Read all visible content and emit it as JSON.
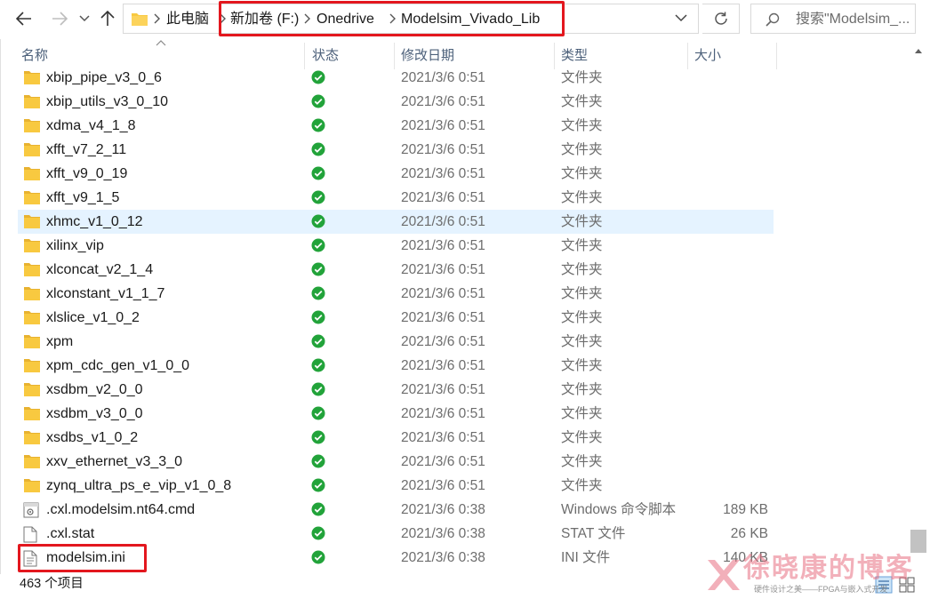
{
  "breadcrumbs": [
    "此电脑",
    "新加卷 (F:)",
    "Onedrive",
    "Modelsim_Vivado_Lib"
  ],
  "search": {
    "placeholder": "搜索\"Modelsim_..."
  },
  "columns": {
    "name": "名称",
    "status": "状态",
    "date": "修改日期",
    "type": "类型",
    "size": "大小"
  },
  "files": [
    {
      "name": "xbip_pipe_v3_0_6",
      "date": "2021/3/6 0:51",
      "type": "文件夹",
      "size": "",
      "icon": "folder-icon"
    },
    {
      "name": "xbip_utils_v3_0_10",
      "date": "2021/3/6 0:51",
      "type": "文件夹",
      "size": "",
      "icon": "folder-icon"
    },
    {
      "name": "xdma_v4_1_8",
      "date": "2021/3/6 0:51",
      "type": "文件夹",
      "size": "",
      "icon": "folder-icon"
    },
    {
      "name": "xfft_v7_2_11",
      "date": "2021/3/6 0:51",
      "type": "文件夹",
      "size": "",
      "icon": "folder-icon"
    },
    {
      "name": "xfft_v9_0_19",
      "date": "2021/3/6 0:51",
      "type": "文件夹",
      "size": "",
      "icon": "folder-icon"
    },
    {
      "name": "xfft_v9_1_5",
      "date": "2021/3/6 0:51",
      "type": "文件夹",
      "size": "",
      "icon": "folder-icon"
    },
    {
      "name": "xhmc_v1_0_12",
      "date": "2021/3/6 0:51",
      "type": "文件夹",
      "size": "",
      "icon": "folder-icon",
      "selected": true
    },
    {
      "name": "xilinx_vip",
      "date": "2021/3/6 0:51",
      "type": "文件夹",
      "size": "",
      "icon": "folder-icon"
    },
    {
      "name": "xlconcat_v2_1_4",
      "date": "2021/3/6 0:51",
      "type": "文件夹",
      "size": "",
      "icon": "folder-icon"
    },
    {
      "name": "xlconstant_v1_1_7",
      "date": "2021/3/6 0:51",
      "type": "文件夹",
      "size": "",
      "icon": "folder-icon"
    },
    {
      "name": "xlslice_v1_0_2",
      "date": "2021/3/6 0:51",
      "type": "文件夹",
      "size": "",
      "icon": "folder-icon"
    },
    {
      "name": "xpm",
      "date": "2021/3/6 0:51",
      "type": "文件夹",
      "size": "",
      "icon": "folder-icon"
    },
    {
      "name": "xpm_cdc_gen_v1_0_0",
      "date": "2021/3/6 0:51",
      "type": "文件夹",
      "size": "",
      "icon": "folder-icon"
    },
    {
      "name": "xsdbm_v2_0_0",
      "date": "2021/3/6 0:51",
      "type": "文件夹",
      "size": "",
      "icon": "folder-icon"
    },
    {
      "name": "xsdbm_v3_0_0",
      "date": "2021/3/6 0:51",
      "type": "文件夹",
      "size": "",
      "icon": "folder-icon"
    },
    {
      "name": "xsdbs_v1_0_2",
      "date": "2021/3/6 0:51",
      "type": "文件夹",
      "size": "",
      "icon": "folder-icon"
    },
    {
      "name": "xxv_ethernet_v3_3_0",
      "date": "2021/3/6 0:51",
      "type": "文件夹",
      "size": "",
      "icon": "folder-icon"
    },
    {
      "name": "zynq_ultra_ps_e_vip_v1_0_8",
      "date": "2021/3/6 0:51",
      "type": "文件夹",
      "size": "",
      "icon": "folder-icon"
    },
    {
      "name": ".cxl.modelsim.nt64.cmd",
      "date": "2021/3/6 0:38",
      "type": "Windows 命令脚本",
      "size": "189 KB",
      "icon": "cmd-file-icon"
    },
    {
      "name": ".cxl.stat",
      "date": "2021/3/6 0:38",
      "type": "STAT 文件",
      "size": "26 KB",
      "icon": "blank-file-icon"
    },
    {
      "name": "modelsim.ini",
      "date": "2021/3/6 0:38",
      "type": "INI 文件",
      "size": "140 KB",
      "icon": "ini-file-icon"
    }
  ],
  "status_bar": {
    "item_count": "463 个项目"
  },
  "watermark": {
    "title": "徐晓康的博客",
    "subtitle": "硬件设计之美——FPGA与嵌入式开发"
  },
  "colors": {
    "highlight": "#e3171e",
    "sync_ok": "#22a33a",
    "folder": "#f8c940",
    "selected_row": "#e5f3ff"
  }
}
